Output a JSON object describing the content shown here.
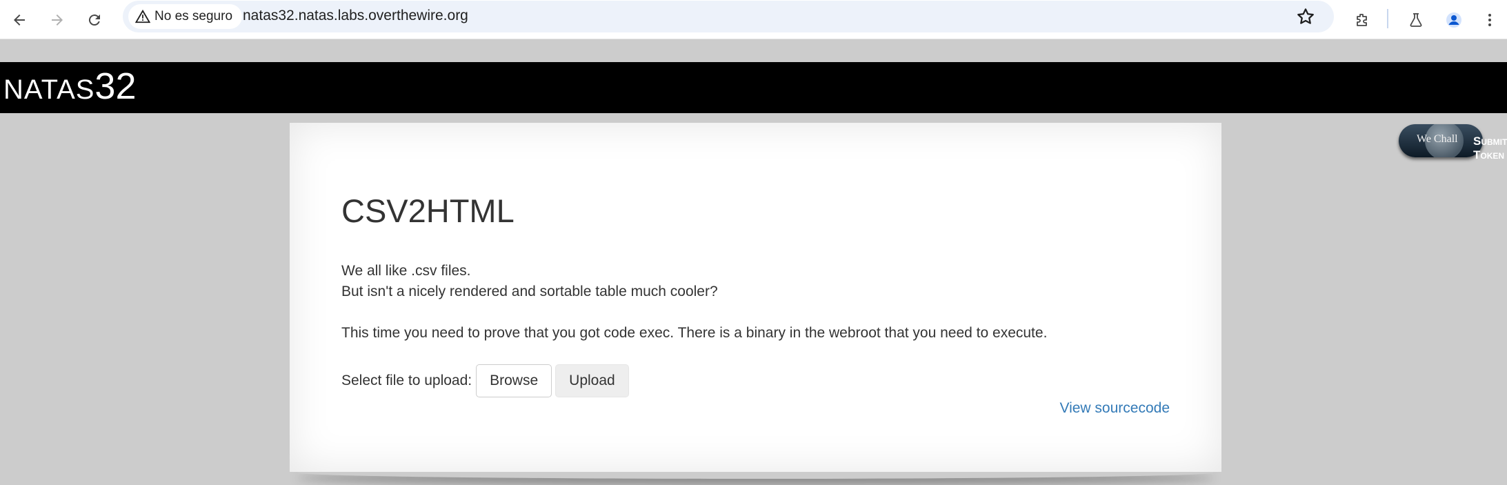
{
  "browser": {
    "security_chip": "No es seguro",
    "url": "natas32.natas.labs.overthewire.org",
    "icons": [
      "back-icon",
      "forward-icon",
      "reload-icon",
      "warning-icon",
      "star-icon",
      "extensions-icon",
      "labs-flask-icon",
      "profile-icon",
      "menu-icon"
    ]
  },
  "header": {
    "logo_text": "NATAS",
    "logo_number": "32"
  },
  "content": {
    "title": "CSV2HTML",
    "line1": "We all like .csv files.",
    "line2": "But isn't a nicely rendered and sortable table much cooler?",
    "line3": "This time you need to prove that you got code exec. There is a binary in the webroot that you need to execute.",
    "upload_label": "Select file to upload:",
    "browse_label": "Browse",
    "upload_button": "Upload",
    "view_source": "View sourcecode"
  },
  "wechall": {
    "badge_text": "We Chall",
    "submit_text": "Submit",
    "token_text": "Token"
  },
  "colors": {
    "page_bg": "#cccccc",
    "header_bg": "#000000",
    "link": "#337ab7",
    "omnibox_bg": "#edf2fa"
  }
}
